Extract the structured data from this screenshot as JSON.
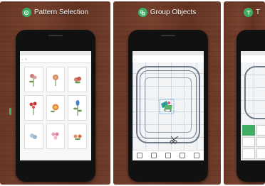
{
  "panels": [
    {
      "title": "Pattern Selection"
    },
    {
      "title": "Group Objects"
    },
    {
      "title": "T"
    }
  ],
  "colors": {
    "accent": "#3fae64",
    "wood": "#6b3a27"
  }
}
